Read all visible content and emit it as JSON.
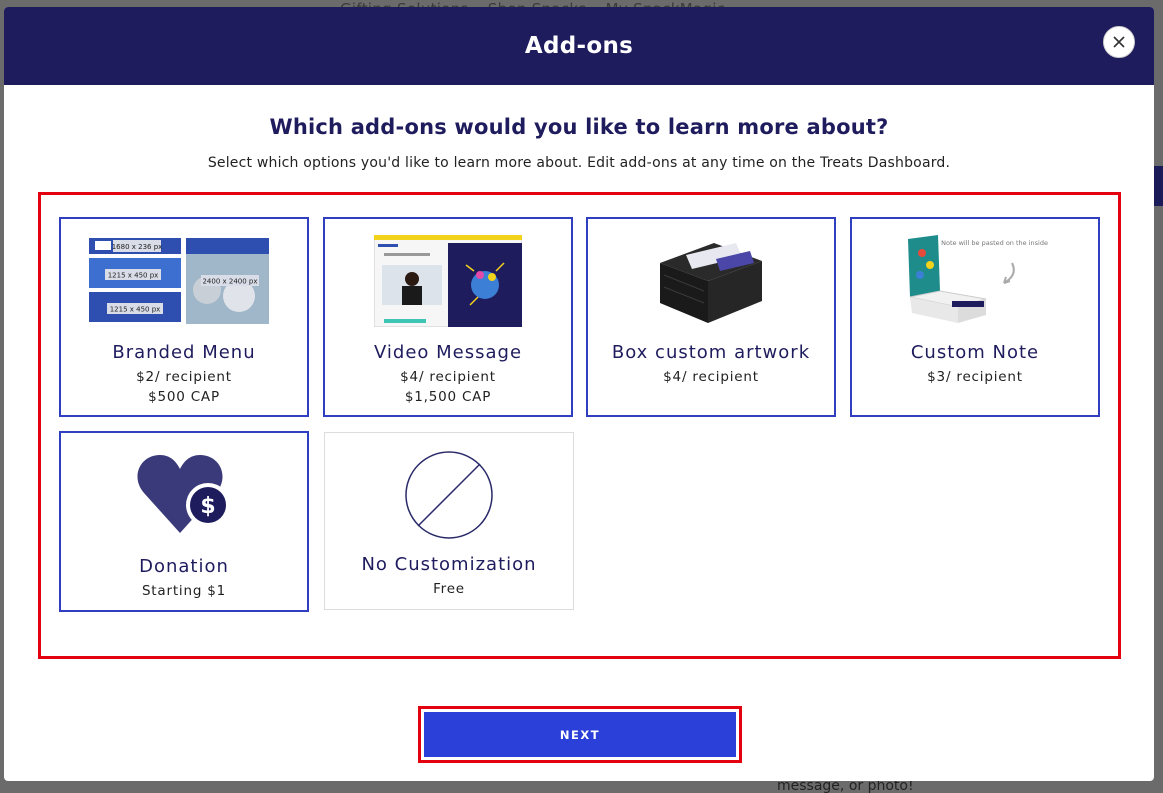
{
  "background": {
    "nav_items": [
      "Gifting Solutions",
      "Shop Snacks",
      "My SnackMagic"
    ],
    "bottom_text": "message, or photo!"
  },
  "modal": {
    "title": "Add-ons",
    "question": "Which add-ons would you like to learn more about?",
    "subtitle": "Select which options you'd like to learn more about. Edit add-ons at any time on the Treats Dashboard.",
    "close_icon": "close-icon",
    "next_label": "NEXT"
  },
  "options": [
    {
      "name": "Branded Menu",
      "price": "$2/ recipient",
      "cap": "$500 CAP",
      "selected": true,
      "thumb_texts": [
        "1680 x 236 px",
        "1215 x 450 px",
        "2400 x 2400 px",
        "1215 x 450 px"
      ]
    },
    {
      "name": "Video Message",
      "price": "$4/ recipient",
      "cap": "$1,500 CAP",
      "selected": true
    },
    {
      "name": "Box custom artwork",
      "price": "$4/ recipient",
      "cap": "",
      "selected": true
    },
    {
      "name": "Custom Note",
      "price": "$3/ recipient",
      "cap": "",
      "selected": true,
      "thumb_note": "Note will be pasted on the inside of the box"
    },
    {
      "name": "Donation",
      "price": "Starting $1",
      "cap": "",
      "selected": true
    },
    {
      "name": "No Customization",
      "price": "Free",
      "cap": "",
      "selected": false
    }
  ],
  "colors": {
    "header_bg": "#1f1c5e",
    "card_border": "#2f3fbf",
    "next_button": "#2b3fd9",
    "highlight": "#e3000f"
  }
}
